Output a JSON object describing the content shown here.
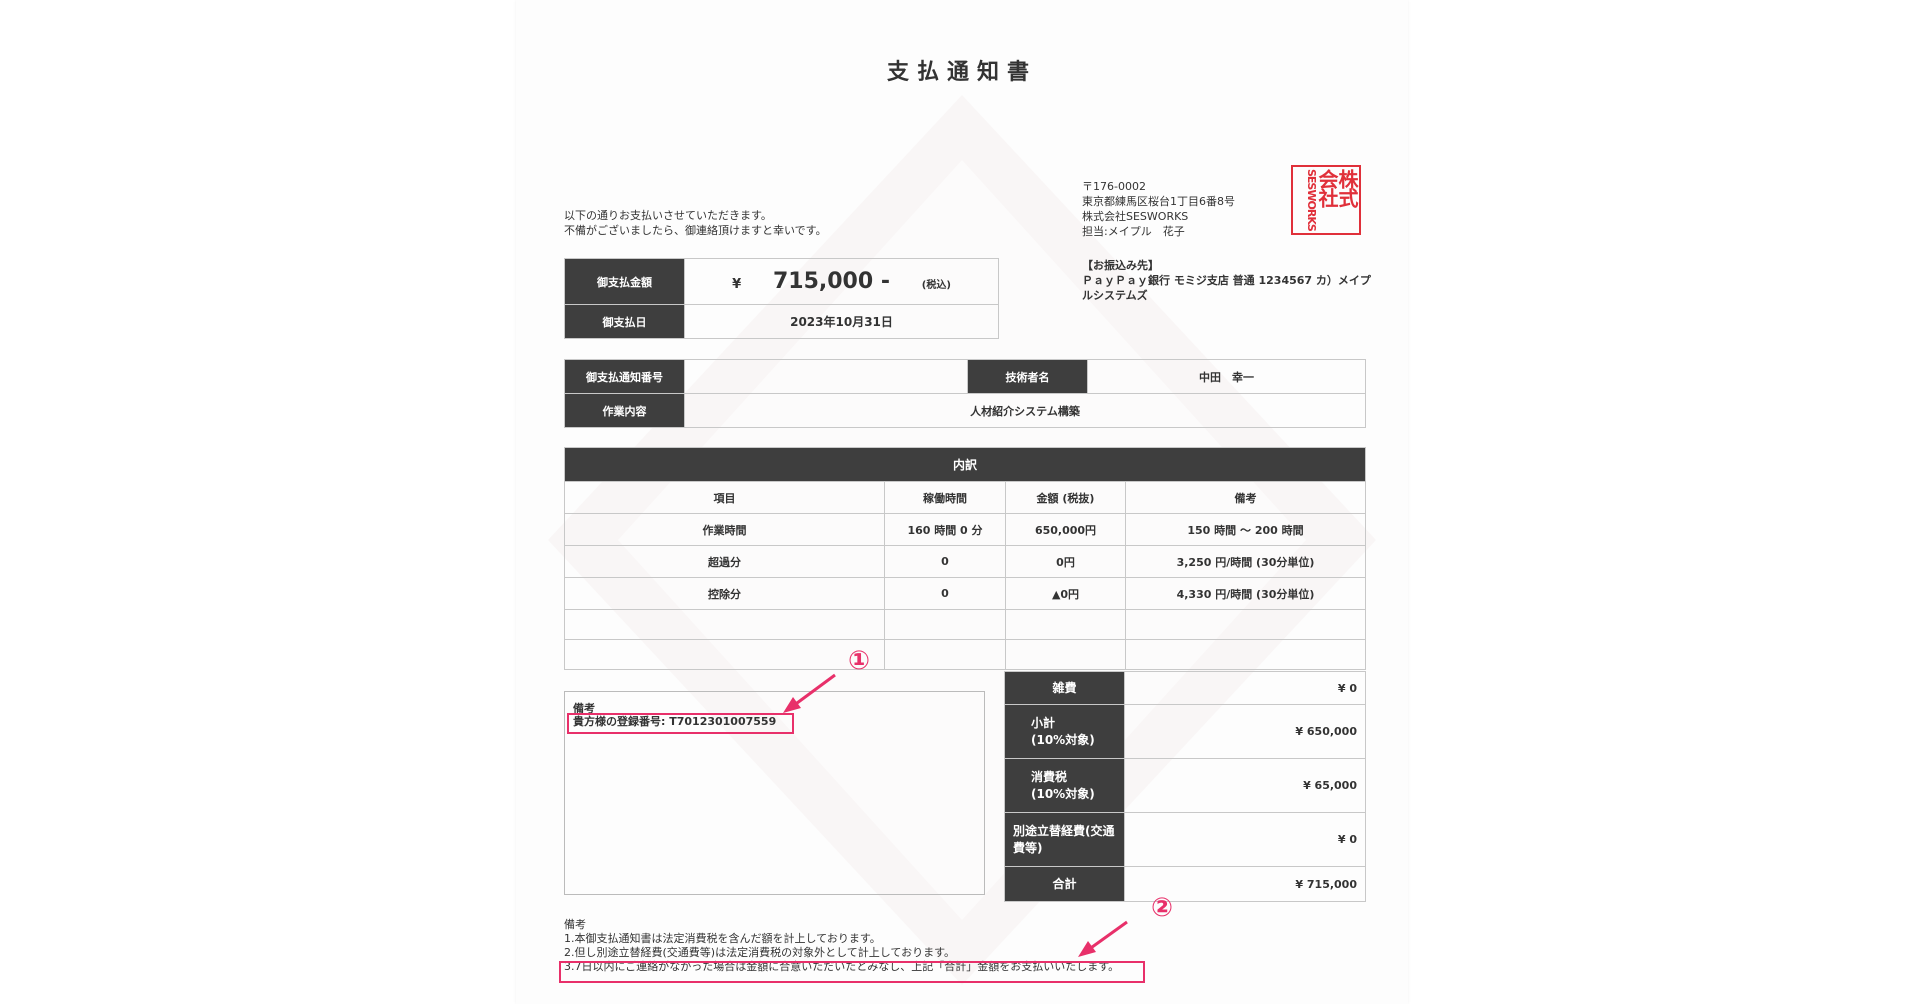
{
  "title": "支払通知書",
  "intro": [
    "以下の通りお支払いさせていただきます。",
    "不備がございましたら、御連絡頂けますと幸いです。"
  ],
  "sender": {
    "postal": "〒176-0002",
    "address": "東京都練馬区桜台1丁目6番8号",
    "company": "株式会社SESWORKS",
    "contact": "担当:メイプル　花子"
  },
  "stamp": {
    "big": [
      "株式",
      "会社"
    ],
    "small": "SESWORKS"
  },
  "bank": {
    "label": "【お振込み先】",
    "detail": "ＰａｙＰａｙ銀行 モミジ支店 普通 1234567 カ）メイプルシステムズ"
  },
  "amount": {
    "label": "御支払金額",
    "currency": "¥",
    "value": "715,000 -",
    "tax": "(税込)",
    "date_label": "御支払日",
    "date": "2023年10月31日"
  },
  "info": {
    "notice_no_label": "御支払通知番号",
    "notice_no": "",
    "engineer_label": "技術者名",
    "engineer": "中田　幸一",
    "work_label": "作業内容",
    "work": "人材紹介システム構築"
  },
  "detail": {
    "title": "内訳",
    "headers": [
      "項目",
      "稼働時間",
      "金額 (税抜)",
      "備考"
    ],
    "rows": [
      [
        "作業時間",
        "160 時間 0 分",
        "650,000円",
        "150 時間 ～ 200 時間"
      ],
      [
        "超過分",
        "0",
        "0円",
        "3,250 円/時間 (30分単位)"
      ],
      [
        "控除分",
        "0",
        "▲0円",
        "4,330 円/時間 (30分単位)"
      ],
      [
        "",
        "",
        "",
        ""
      ],
      [
        "",
        "",
        "",
        ""
      ]
    ]
  },
  "summary": [
    {
      "label": "雑費",
      "value": "¥ 0"
    },
    {
      "label": "小計\n(10%対象)",
      "value": "¥ 650,000"
    },
    {
      "label": "消費税\n(10%対象)",
      "value": "¥ 65,000"
    },
    {
      "label": "別途立替経費(交通費等)",
      "value": "¥ 0"
    },
    {
      "label": "合計",
      "value": "¥ 715,000"
    }
  ],
  "remarks": {
    "label": "備考",
    "registration": "貴方様の登録番号: T7012301007559"
  },
  "notes": {
    "label": "備考",
    "items": [
      "1.本御支払通知書は法定消費税を含んだ額を計上しております。",
      "2.但し別途立替経費(交通費等)は法定消費税の対象外として計上しております。",
      "3.7日以内にご連絡がなかった場合は金額に合意いただいたとみなし、上記「合計」金額をお支払いいたします。"
    ]
  },
  "markers": [
    "①",
    "②"
  ],
  "colors": {
    "dark_header": "#3e3e3e",
    "highlight": "#e8306a",
    "stamp": "#e0303a"
  }
}
